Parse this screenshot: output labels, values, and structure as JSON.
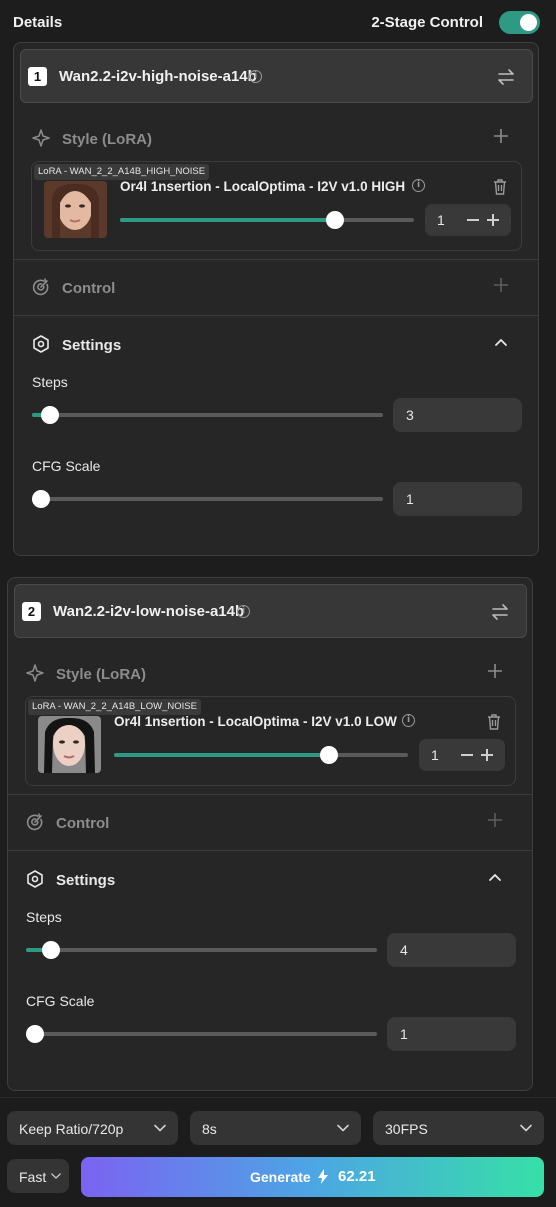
{
  "header": {
    "title": "Details",
    "two_stage_label": "2-Stage Control",
    "two_stage_on": true
  },
  "stages": [
    {
      "number": "1",
      "model": "Wan2.2-i2v-high-noise-a14b",
      "style_label": "Style (LoRA)",
      "lora": {
        "tag": "LoRA - WAN_2_2_A14B_HIGH_NOISE",
        "name": "Or4l 1nsertion - LocalOptima - I2V v1.0 HIGH",
        "strength": "1",
        "slider_fraction": 0.73
      },
      "control_label": "Control",
      "settings_label": "Settings",
      "steps_label": "Steps",
      "steps_value": "3",
      "steps_fraction": 0.05,
      "cfg_label": "CFG Scale",
      "cfg_value": "1",
      "cfg_fraction": 0.0
    },
    {
      "number": "2",
      "model": "Wan2.2-i2v-low-noise-a14b",
      "style_label": "Style (LoRA)",
      "lora": {
        "tag": "LoRA - WAN_2_2_A14B_LOW_NOISE",
        "name": "Or4l 1nsertion - LocalOptima - I2V v1.0 LOW",
        "strength": "1",
        "slider_fraction": 0.73
      },
      "control_label": "Control",
      "settings_label": "Settings",
      "steps_label": "Steps",
      "steps_value": "4",
      "steps_fraction": 0.07,
      "cfg_label": "CFG Scale",
      "cfg_value": "1",
      "cfg_fraction": 0.0
    }
  ],
  "bottom": {
    "ratio": "Keep Ratio/720p",
    "duration": "8s",
    "fps": "30FPS",
    "speed": "Fast",
    "generate_label": "Generate",
    "cost": "62.21"
  },
  "colors": {
    "accent": "#2f9a84",
    "background": "#1d1d1d",
    "panel": "#262626"
  }
}
